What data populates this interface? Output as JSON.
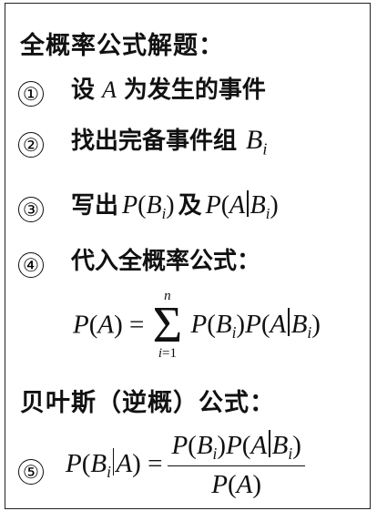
{
  "heading_full_prob": "全概率公式解题：",
  "steps": [
    {
      "num": "①",
      "text": "设",
      "math_var": "A",
      "text_after": "为发生的事件"
    },
    {
      "num": "②",
      "text": "找出完备事件组",
      "math_var": "B",
      "math_sub": "i"
    },
    {
      "num": "③",
      "text": "写出",
      "mid_text": "及"
    },
    {
      "num": "④",
      "text": "代入全概率公式："
    }
  ],
  "formula_total": {
    "lhs": "P(A) =",
    "sum_upper": "n",
    "sum_lower": "i=1",
    "sigma": "Σ"
  },
  "heading_bayes": "贝叶斯（逆概）公式：",
  "step5_num": "⑤"
}
